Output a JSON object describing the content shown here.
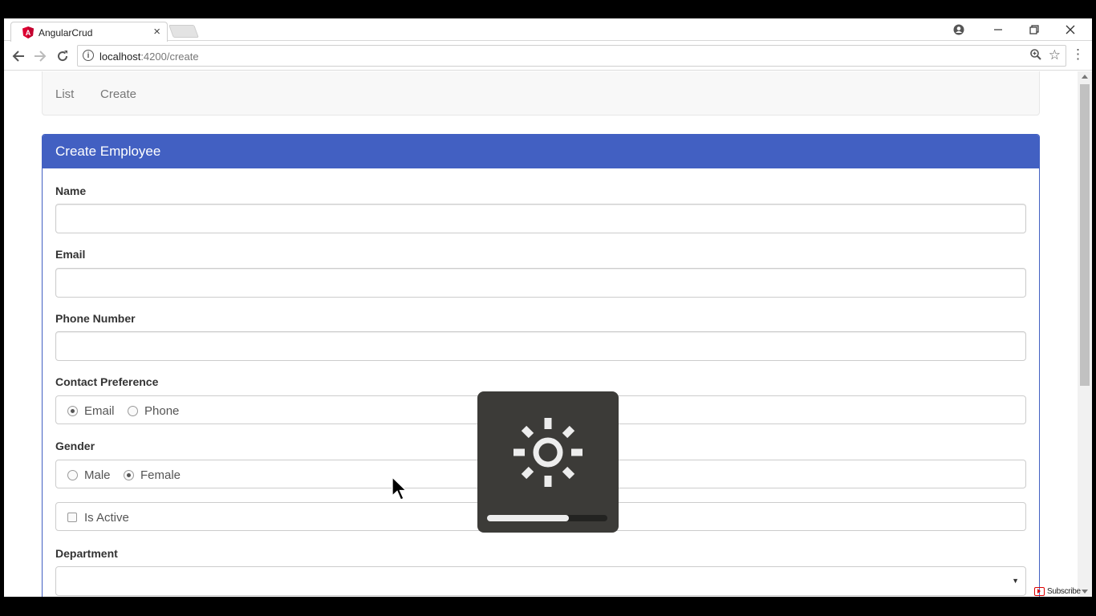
{
  "browser": {
    "tab_title": "AngularCrud",
    "tab_close": "×",
    "url_host": "localhost",
    "url_path": ":4200/create",
    "icons": {
      "favicon": "angular-logo-icon",
      "back": "arrow-left-icon",
      "forward": "arrow-right-icon",
      "reload": "reload-icon",
      "info": "info-icon",
      "zoom": "zoom-icon",
      "bookmark": "star-icon",
      "menu": "kebab-menu-icon",
      "profile": "account-icon",
      "minimize": "minimize-icon",
      "restore": "restore-icon",
      "close": "close-icon"
    }
  },
  "nav": {
    "links": [
      "List",
      "Create"
    ]
  },
  "form": {
    "panel_title": "Create Employee",
    "panel_color": "#4260c2",
    "name_label": "Name",
    "name_value": "",
    "email_label": "Email",
    "email_value": "",
    "phone_label": "Phone Number",
    "phone_value": "",
    "contact_label": "Contact Preference",
    "contact_options": [
      "Email",
      "Phone"
    ],
    "contact_selected": "Email",
    "gender_label": "Gender",
    "gender_options": [
      "Male",
      "Female"
    ],
    "gender_selected": "Female",
    "is_active_label": "Is Active",
    "is_active_checked": false,
    "department_label": "Department",
    "department_value": ""
  },
  "overlay": {
    "icon": "brightness-sun-icon",
    "brightness_level": 0.68
  },
  "youtube": {
    "subscribe_label": "Subscribe",
    "icon": "youtube-logo-icon"
  }
}
